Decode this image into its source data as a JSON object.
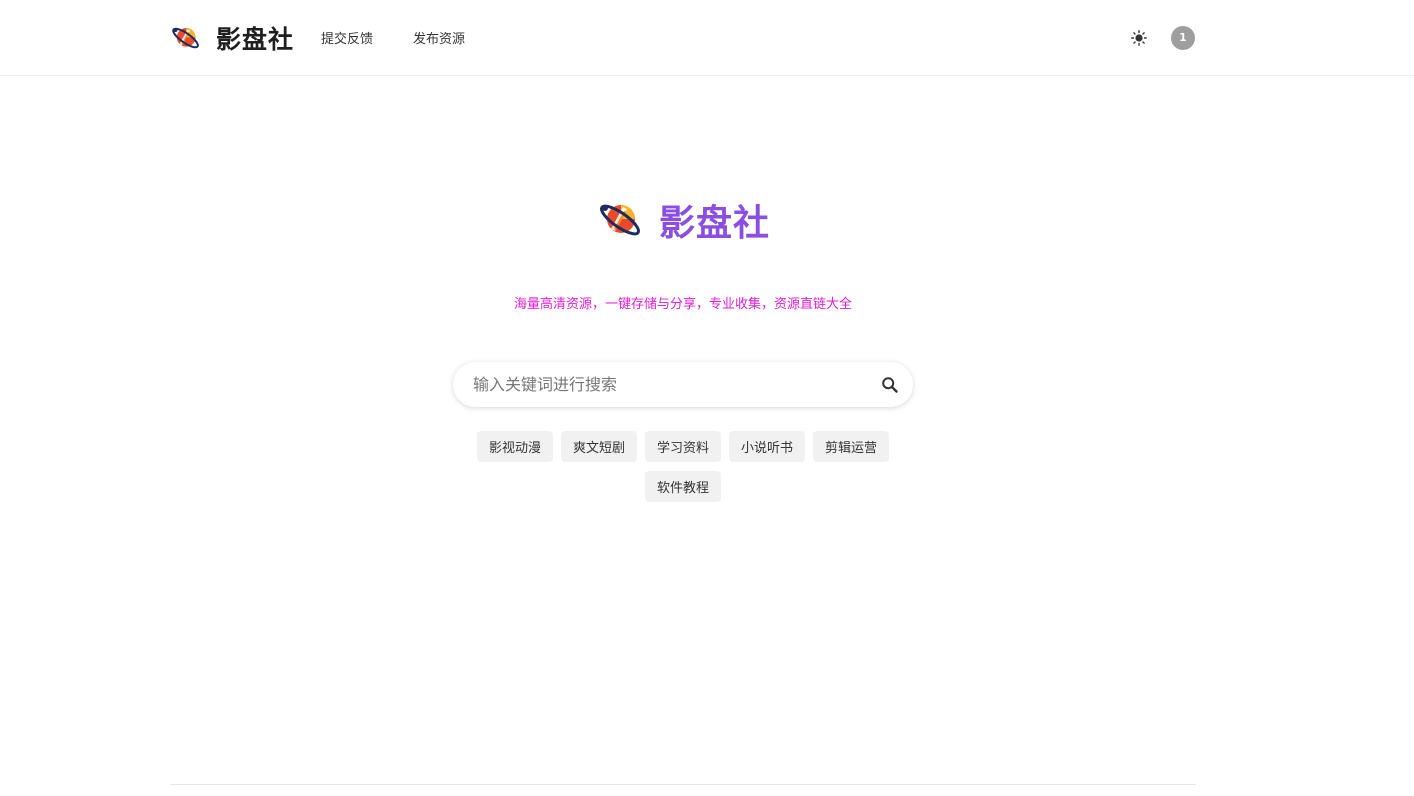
{
  "header": {
    "brand_name": "影盘社",
    "nav": [
      {
        "label": "提交反馈"
      },
      {
        "label": "发布资源"
      }
    ],
    "theme_icon": "sun-icon",
    "notification_count": "1"
  },
  "hero": {
    "title": "影盘社",
    "tagline": "海量高清资源，一键存储与分享，专业收集，资源直链大全",
    "title_color": "#8a4fe0",
    "tagline_color": "#e01ed6"
  },
  "search": {
    "placeholder": "输入关键词进行搜索",
    "value": "",
    "icon": "search-icon"
  },
  "categories": [
    {
      "label": "影视动漫"
    },
    {
      "label": "爽文短剧"
    },
    {
      "label": "学习资料"
    },
    {
      "label": "小说听书"
    },
    {
      "label": "剪辑运营"
    },
    {
      "label": "软件教程"
    }
  ]
}
